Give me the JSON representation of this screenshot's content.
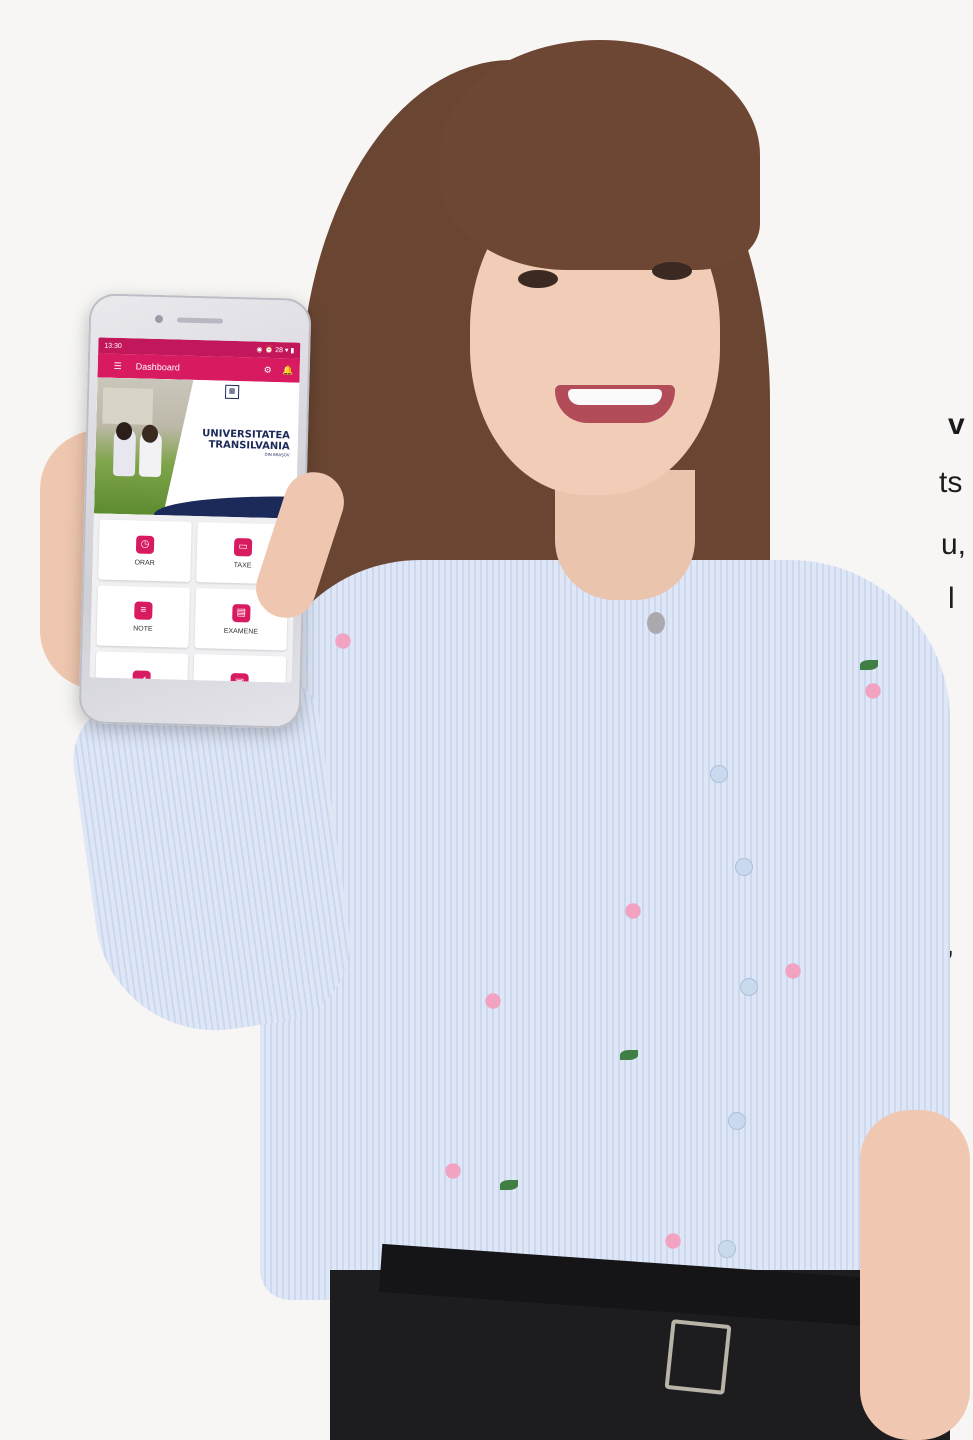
{
  "fragments": {
    "line1": "v",
    "line2": "ts",
    "line3": "u,",
    "line4": "l",
    "line5": ","
  },
  "phone": {
    "status": {
      "time": "13:30",
      "right": "◉ ⏰ 28 ▾ ▮"
    },
    "appbar": {
      "title": "Dashboard",
      "menu_icon": "menu-icon",
      "settings_icon": "gear-icon",
      "notify_icon": "bell-icon"
    },
    "banner": {
      "crest": "▦",
      "uni_line1": "UNIVERSITATEA",
      "uni_line2": "TRANSILVANIA",
      "uni_line3": "DIN BRAȘOV"
    },
    "tiles": [
      {
        "label": "ORAR",
        "icon": "clock-icon",
        "glyph": "◷"
      },
      {
        "label": "TAXE",
        "icon": "card-icon",
        "glyph": "▭"
      },
      {
        "label": "NOTE",
        "icon": "notes-icon",
        "glyph": "≡"
      },
      {
        "label": "EXAMENE",
        "icon": "document-icon",
        "glyph": "▤"
      },
      {
        "label": "",
        "icon": "megaphone-icon",
        "glyph": "◢"
      },
      {
        "label": "",
        "icon": "calendar-icon",
        "glyph": "▣"
      }
    ]
  },
  "colors": {
    "brand_pink": "#d81b60",
    "status_pink": "#c2185b",
    "uni_navy": "#1c2a5a"
  }
}
